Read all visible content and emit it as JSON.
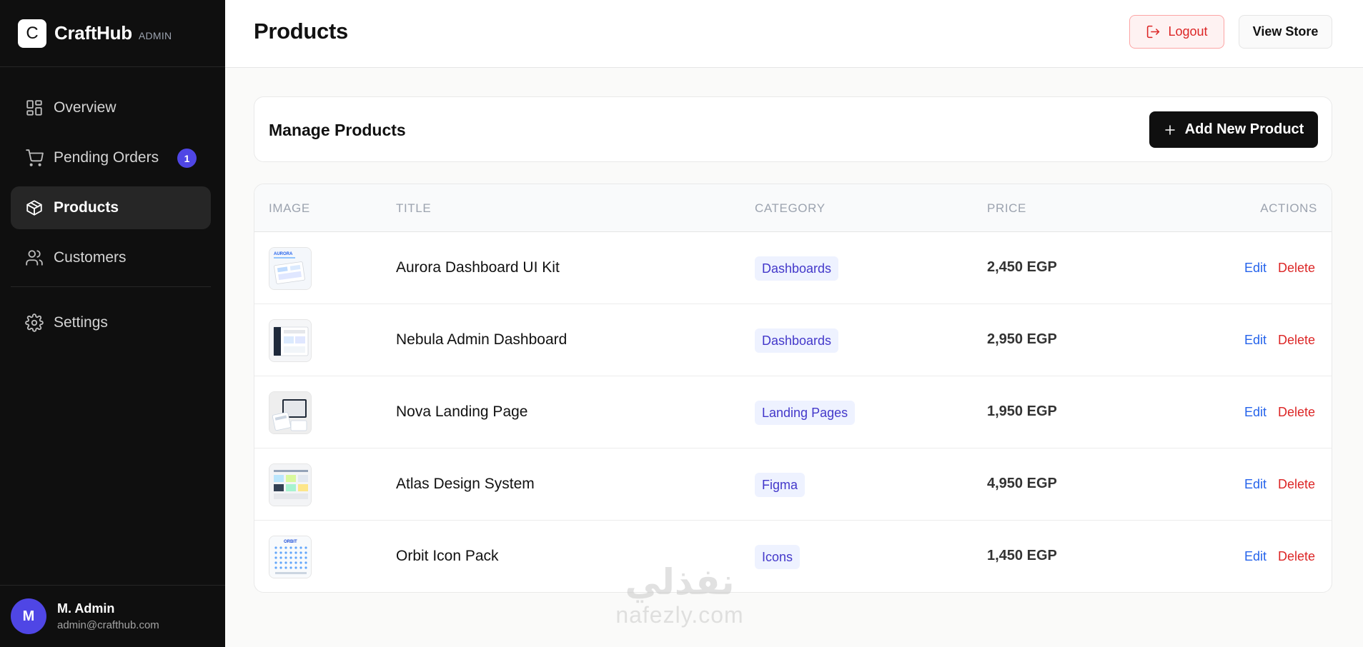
{
  "brand": {
    "logo_letter": "C",
    "name": "CraftHub",
    "tag": "ADMIN"
  },
  "sidebar": {
    "items": [
      {
        "label": "Overview",
        "icon": "grid-icon"
      },
      {
        "label": "Pending Orders",
        "icon": "cart-icon",
        "badge": "1"
      },
      {
        "label": "Products",
        "icon": "box-icon",
        "active": true
      },
      {
        "label": "Customers",
        "icon": "users-icon"
      },
      {
        "label": "Settings",
        "icon": "gear-icon"
      }
    ]
  },
  "user": {
    "initial": "M",
    "name": "M. Admin",
    "email": "admin@crafthub.com"
  },
  "header": {
    "title": "Products",
    "logout_label": "Logout",
    "view_store_label": "View Store"
  },
  "manage": {
    "title": "Manage Products",
    "add_label": "Add New Product"
  },
  "table": {
    "columns": {
      "image": "IMAGE",
      "title": "TITLE",
      "category": "CATEGORY",
      "price": "PRICE",
      "actions": "ACTIONS"
    },
    "edit_label": "Edit",
    "delete_label": "Delete",
    "rows": [
      {
        "title": "Aurora Dashboard UI Kit",
        "category": "Dashboards",
        "price": "2,450 EGP",
        "thumb_text": "AURORA"
      },
      {
        "title": "Nebula Admin Dashboard",
        "category": "Dashboards",
        "price": "2,950 EGP"
      },
      {
        "title": "Nova Landing Page",
        "category": "Landing Pages",
        "price": "1,950 EGP"
      },
      {
        "title": "Atlas Design System",
        "category": "Figma",
        "price": "4,950 EGP"
      },
      {
        "title": "Orbit Icon Pack",
        "category": "Icons",
        "price": "1,450 EGP",
        "thumb_text": "ORBIT"
      }
    ]
  },
  "watermark": {
    "arabic": "نفذلي",
    "latin": "nafezly.com"
  },
  "colors": {
    "accent": "#4f46e5",
    "danger": "#dc2626",
    "link": "#2563eb",
    "sidebar_bg": "#0f0f0f"
  }
}
